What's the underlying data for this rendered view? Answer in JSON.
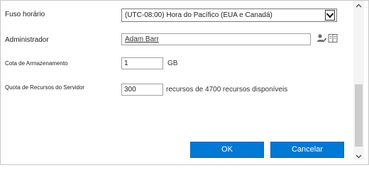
{
  "fields": {
    "timezone_label": "Fuso horário",
    "timezone_value": "(UTC-08:00) Hora do Pacífico (EUA e Canadá)",
    "admin_label": "Administrador",
    "admin_value": "Adam Barr",
    "storage_label": "Cota de Armazenamento",
    "storage_value": "1",
    "storage_unit": "GB",
    "resource_label": "Quota de Recursos do Servidor",
    "resource_value": "300",
    "resource_suffix": "recursos de 4700 recursos disponíveis"
  },
  "buttons": {
    "ok": "OK",
    "cancel": "Cancelar"
  },
  "icons": {
    "timezone_dropdown": "chevron-down-icon",
    "check_names": "check-names-icon",
    "browse": "address-book-icon",
    "scroll_up": "chevron-up-icon",
    "scroll_down": "chevron-down-icon"
  },
  "colors": {
    "primary_button": "#0078d4"
  }
}
